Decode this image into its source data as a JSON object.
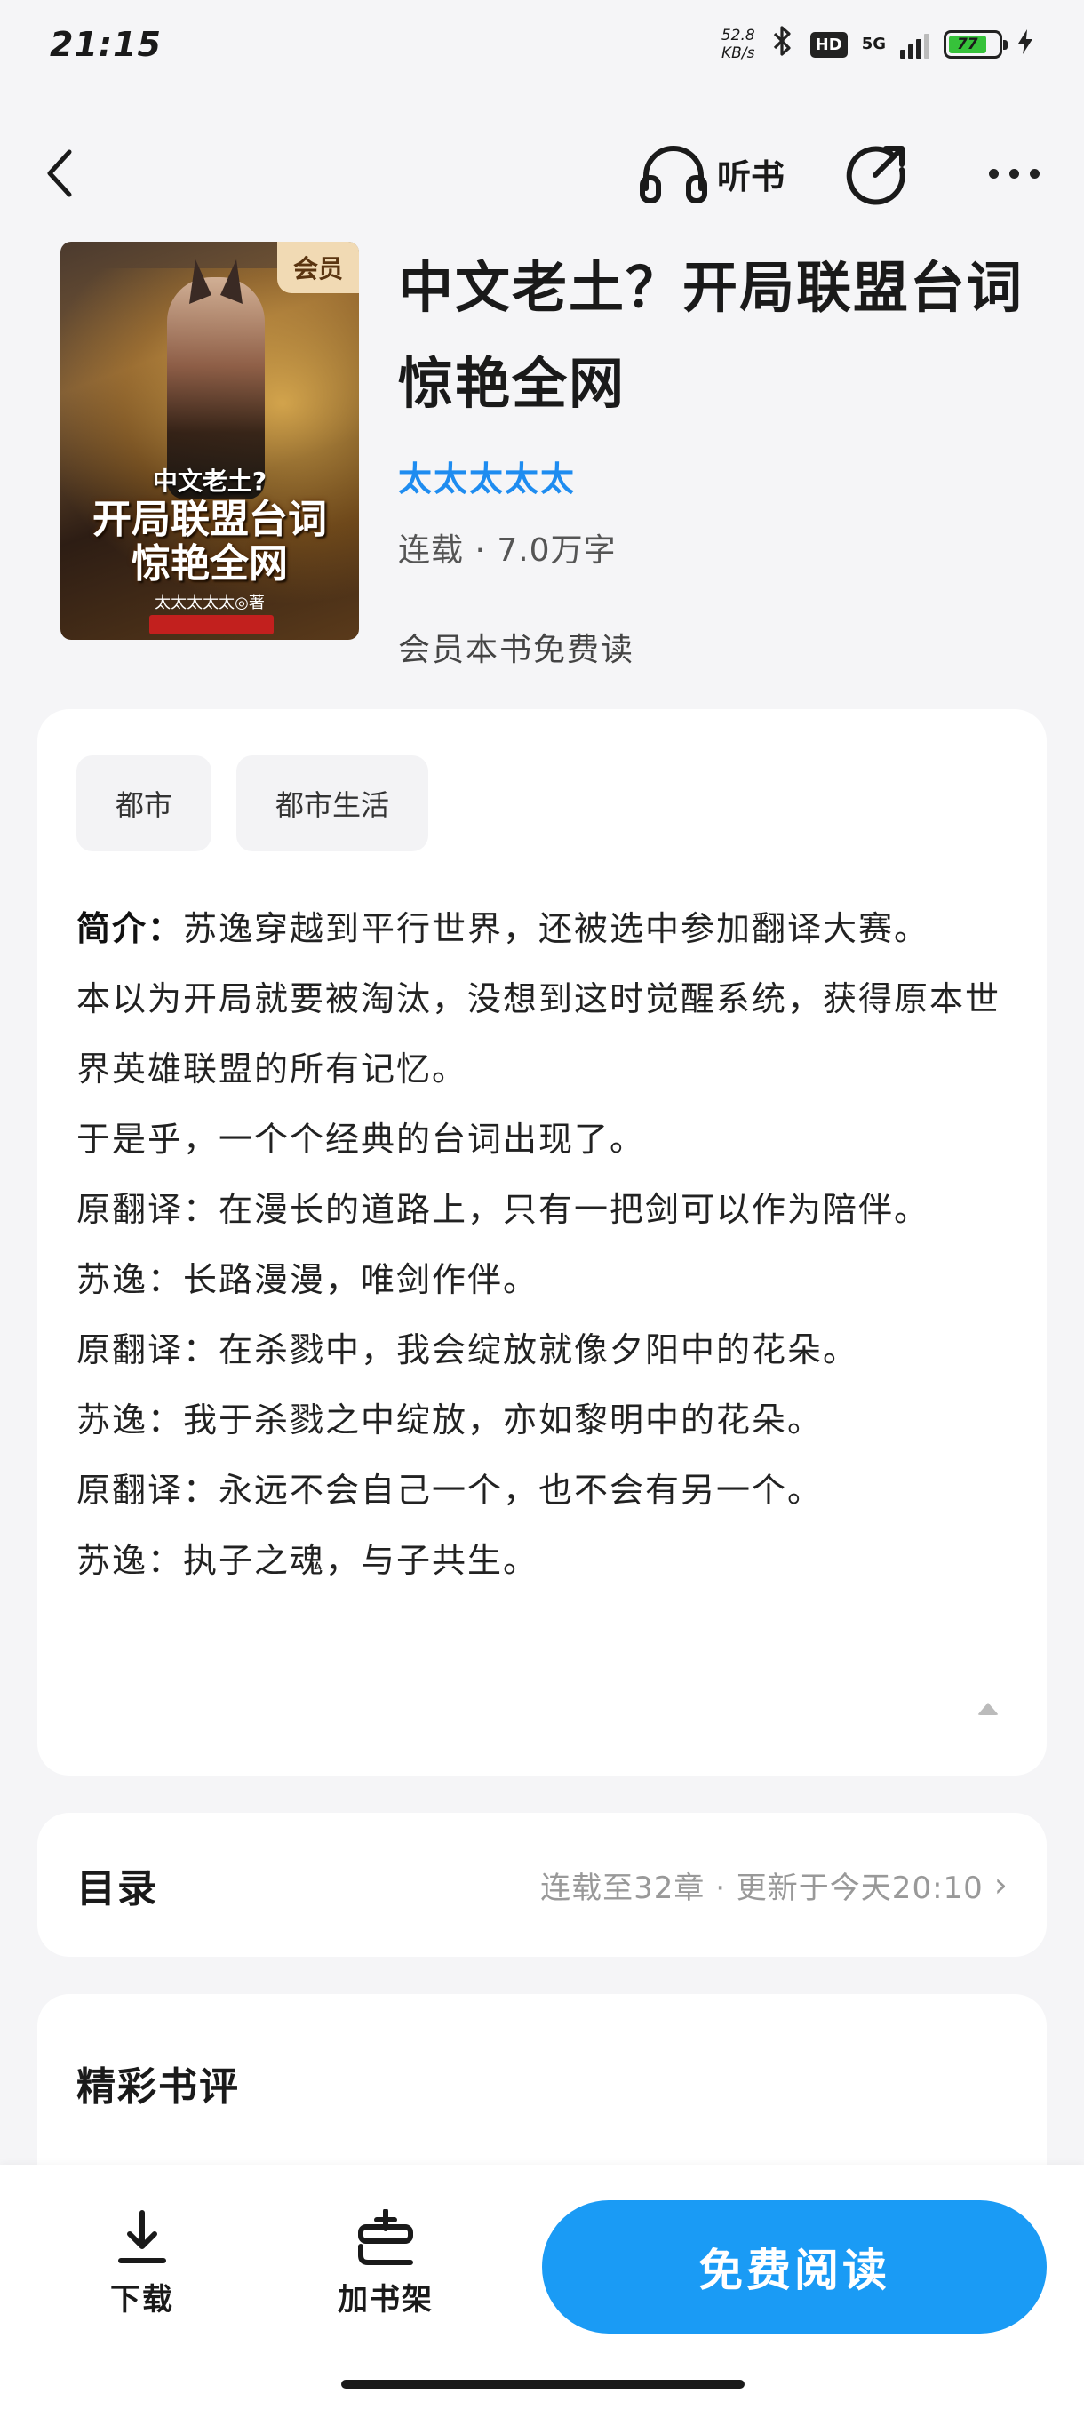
{
  "status_bar": {
    "time": "21:15",
    "net_speed_value": "52.8",
    "net_speed_unit": "KB/s",
    "hd_label": "HD",
    "network_label": "5G",
    "battery_level": "77",
    "icons": [
      "bluetooth-icon",
      "signal-icon",
      "battery-icon",
      "charging-icon"
    ]
  },
  "nav": {
    "listen_label": "听书",
    "icons": [
      "back-icon",
      "headphones-icon",
      "share-icon",
      "more-icon"
    ]
  },
  "book": {
    "title": "中文老土？开局联盟台词惊艳全网",
    "author": "太太太太太",
    "meta": "连载 · 7.0万字",
    "vip_note": "会员本书免费读",
    "cover": {
      "badge": "会员",
      "title_small": "中文老土?",
      "title_large_line1": "开局联盟台词",
      "title_large_line2": "惊艳全网",
      "author_line": "太太太太太◎著"
    }
  },
  "tags": [
    "都市",
    "都市生活"
  ],
  "intro": {
    "label": "简介：",
    "lines": [
      "苏逸穿越到平行世界，还被选中参加翻译大赛。",
      "本以为开局就要被淘汰，没想到这时觉醒系统，获得原本世界英雄联盟的所有记忆。",
      "于是乎，一个个经典的台词出现了。",
      "原翻译：在漫长的道路上，只有一把剑可以作为陪伴。",
      "苏逸：长路漫漫，唯剑作伴。",
      "原翻译：在杀戮中，我会绽放就像夕阳中的花朵。",
      "苏逸：我于杀戮之中绽放，亦如黎明中的花朵。",
      "原翻译：永远不会自己一个，也不会有另一个。",
      "苏逸：执子之魂，与子共生。"
    ]
  },
  "toc": {
    "title": "目录",
    "status": "连载至32章 · 更新于今天20:10",
    "chevron": "›"
  },
  "reviews": {
    "title": "精彩书评"
  },
  "bottom_bar": {
    "download_label": "下载",
    "shelf_label": "加书架",
    "read_label": "免费阅读"
  },
  "colors": {
    "accent": "#1a9bf5",
    "author": "#1e8cf0",
    "background": "#f5f5f7"
  }
}
